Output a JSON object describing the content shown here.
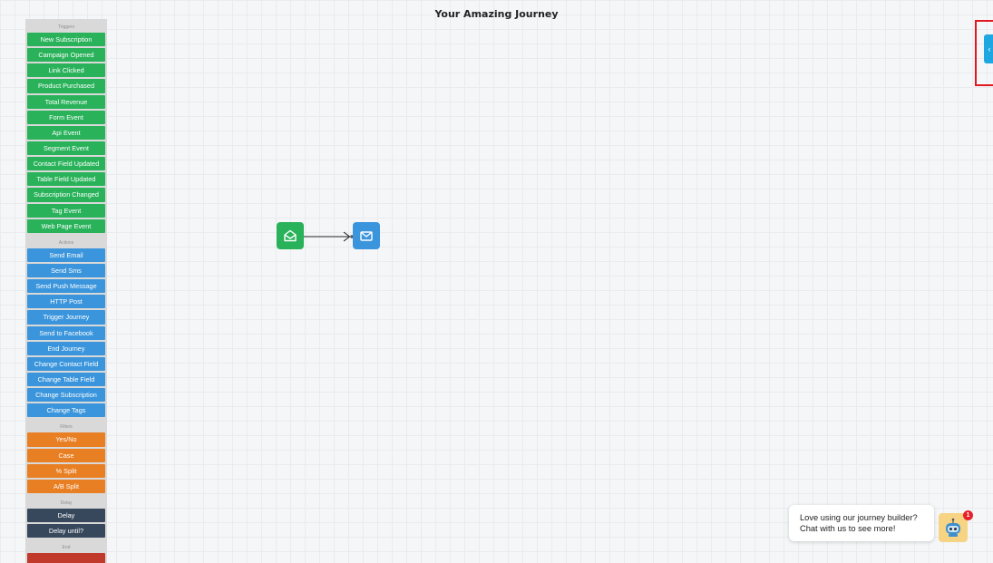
{
  "header": {
    "title": "Your Amazing Journey"
  },
  "palette": {
    "triggers_label": "Triggers",
    "triggers": [
      "New Subscription",
      "Campaign Opened",
      "Link Clicked",
      "Product Purchased",
      "Total Revenue",
      "Form Event",
      "Api Event",
      "Segment Event",
      "Contact Field Updated",
      "Table Field Updated",
      "Subscription Changed",
      "Tag Event",
      "Web Page Event"
    ],
    "actions_label": "Actions",
    "actions": [
      "Send Email",
      "Send Sms",
      "Send Push Message",
      "HTTP Post",
      "Trigger Journey",
      "Send to Facebook",
      "End Journey",
      "Change Contact Field",
      "Change Table Field",
      "Change Subscription",
      "Change Tags"
    ],
    "filters_label": "Filters",
    "filters": [
      "Yes/No",
      "Case",
      "% Split",
      "A/B Split"
    ],
    "delay_label": "Delay",
    "delays": [
      "Delay",
      "Delay until?"
    ],
    "end_label": "End",
    "end": [
      ""
    ]
  },
  "canvas": {
    "nodes": [
      {
        "type": "trigger",
        "icon": "envelope-open-icon"
      },
      {
        "type": "action",
        "icon": "envelope-icon"
      }
    ]
  },
  "chat": {
    "line1": "Love using our journey builder?",
    "line2": "Chat with us to see more!",
    "badge": "1"
  },
  "colors": {
    "trigger": "#29b25a",
    "action": "#3a95dc",
    "filter": "#e97f23",
    "delay": "#37485c",
    "end": "#c0392b",
    "toggle": "#1ea7e1",
    "highlight": "#e0181f"
  }
}
